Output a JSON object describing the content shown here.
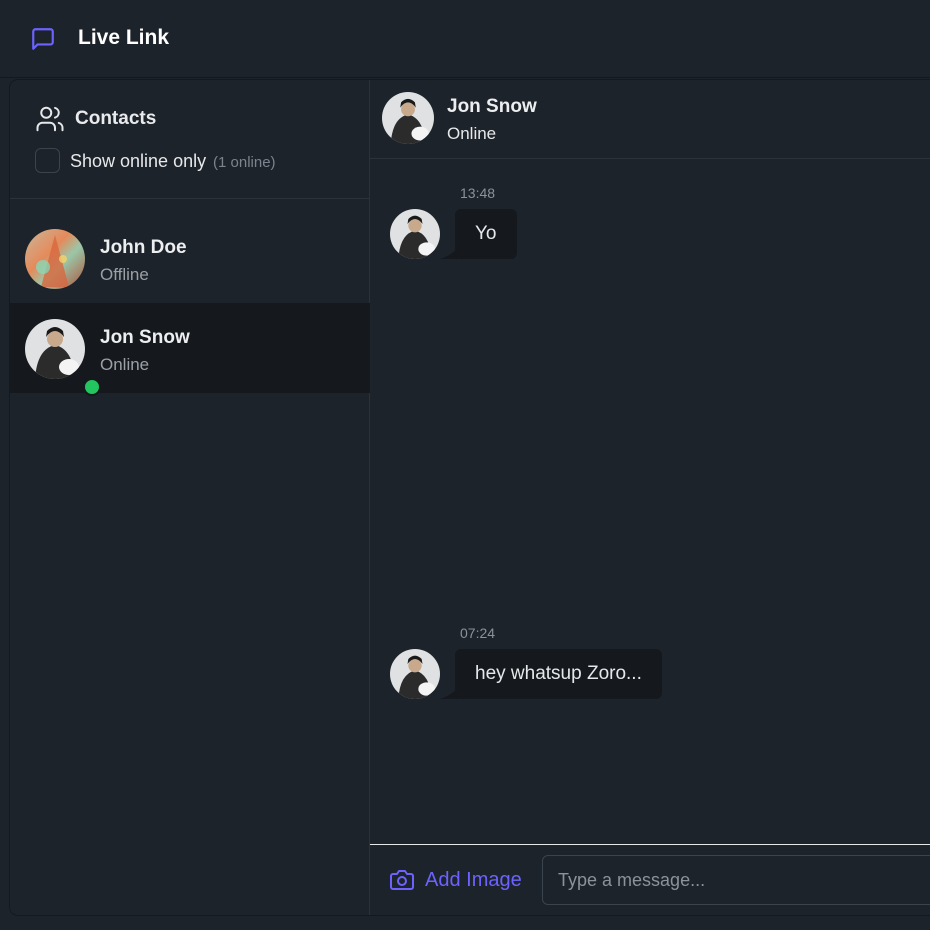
{
  "app": {
    "title": "Live Link",
    "accent": "#6c63ff"
  },
  "sidebar": {
    "title": "Contacts",
    "filter_label": "Show online only",
    "online_count": "(1 online)",
    "contacts": [
      {
        "name": "John Doe",
        "status": "Offline",
        "online": false,
        "selected": false
      },
      {
        "name": "Jon Snow",
        "status": "Online",
        "online": true,
        "selected": true
      }
    ]
  },
  "chat": {
    "name": "Jon Snow",
    "status": "Online",
    "messages": [
      {
        "time": "13:48",
        "text": "Yo"
      },
      {
        "time": "07:24",
        "text": "hey whatsup Zoro..."
      }
    ],
    "add_image_label": "Add Image",
    "input_placeholder": "Type a message..."
  }
}
